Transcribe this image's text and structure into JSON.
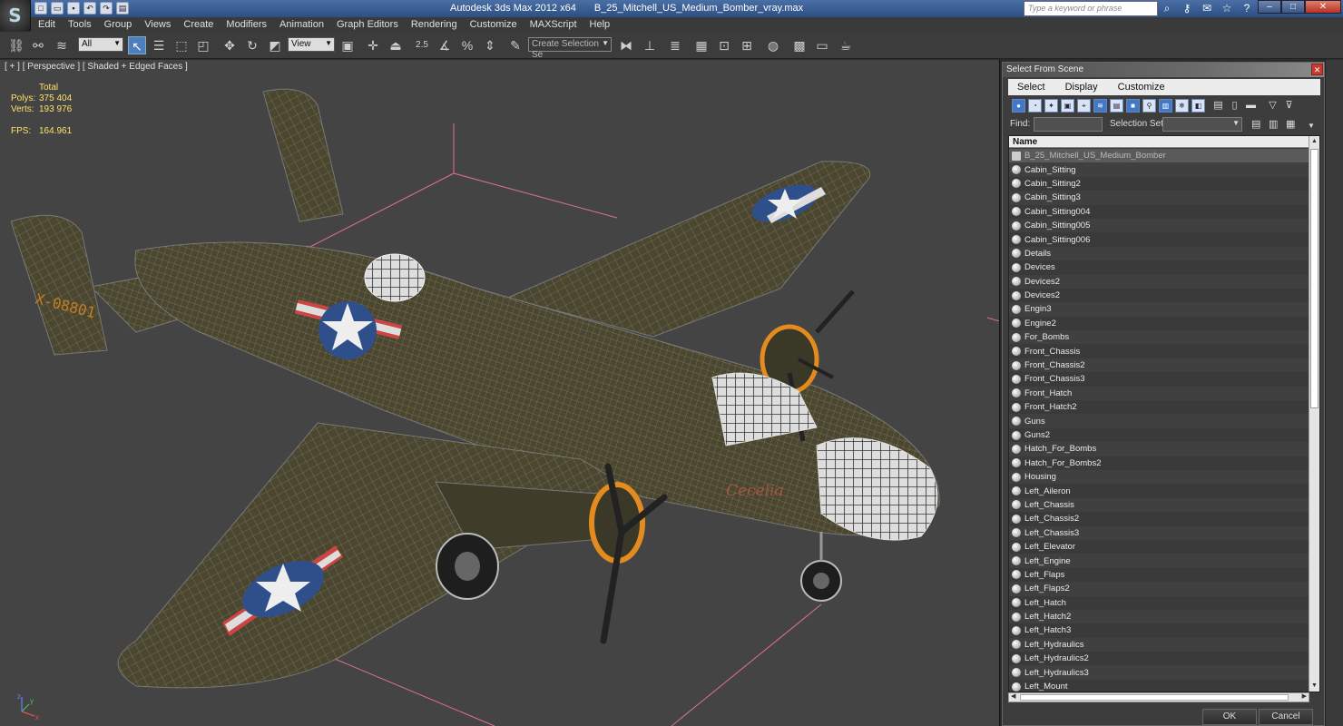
{
  "titlebar": {
    "app": "Autodesk 3ds Max  2012 x64",
    "file": "B_25_Mitchell_US_Medium_Bomber_vray.max",
    "help_placeholder": "Type a keyword or phrase",
    "logo_icon": "3ds-max-logo-icon"
  },
  "menu": [
    "Edit",
    "Tools",
    "Group",
    "Views",
    "Create",
    "Modifiers",
    "Animation",
    "Graph Editors",
    "Rendering",
    "Customize",
    "MAXScript",
    "Help"
  ],
  "toolbar": {
    "selection_filter": "All",
    "reference_coord": "View",
    "snap_angle_label": "2.5",
    "named_selection_placeholder": "Create Selection Se"
  },
  "viewport": {
    "label": "[ + ] [ Perspective ] [ Shaded + Edged Faces ]",
    "stats": {
      "header": "Total",
      "polys_label": "Polys:",
      "polys": "375 404",
      "verts_label": "Verts:",
      "verts": "193 976",
      "fps_label": "FPS:",
      "fps": "164.961"
    },
    "axis_labels": {
      "x": "x",
      "y": "y",
      "z": "z"
    }
  },
  "dialog": {
    "title": "Select From Scene",
    "menu": [
      "Select",
      "Display",
      "Customize"
    ],
    "find_label": "Find:",
    "selection_set_label": "Selection Set:",
    "column_header": "Name",
    "ok": "OK",
    "cancel": "Cancel",
    "items": [
      "B_25_Mitchell_US_Medium_Bomber",
      "Cabin_Sitting",
      "Cabin_Sitting2",
      "Cabin_Sitting3",
      "Cabin_Sitting004",
      "Cabin_Sitting005",
      "Cabin_Sitting006",
      "Details",
      "Devices",
      "Devices2",
      "Devices2",
      "Engin3",
      "Engine2",
      "For_Bombs",
      "Front_Chassis",
      "Front_Chassis2",
      "Front_Chassis3",
      "Front_Hatch",
      "Front_Hatch2",
      "Guns",
      "Guns2",
      "Hatch_For_Bombs",
      "Hatch_For_Bombs2",
      "Housing",
      "Left_Aileron",
      "Left_Chassis",
      "Left_Chassis2",
      "Left_Chassis3",
      "Left_Elevator",
      "Left_Engine",
      "Left_Flaps",
      "Left_Flaps2",
      "Left_Hatch",
      "Left_Hatch2",
      "Left_Hatch3",
      "Left_Hydraulics",
      "Left_Hydraulics2",
      "Left_Hydraulics3",
      "Left_Mount"
    ]
  },
  "colors": {
    "stats_text": "#ffe06a",
    "selection_active": "#4c7fc0",
    "aircraft_olive": "#4a4630",
    "insignia_blue": "#2f4f8a",
    "engine_cowl_orange": "#e38b1e"
  }
}
